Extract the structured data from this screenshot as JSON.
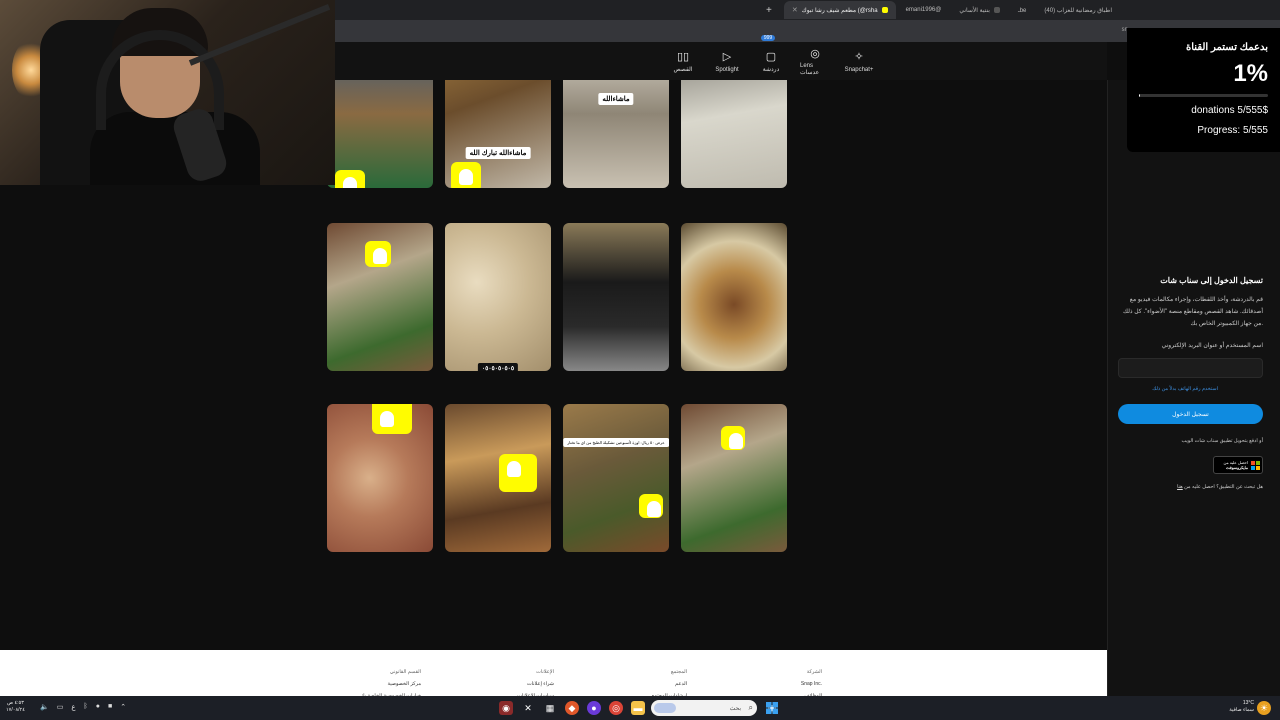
{
  "browser": {
    "tabs": [
      {
        "title": "(40) اطباق رمضانية للعزاب"
      },
      {
        "title": "ـbe"
      },
      {
        "title": "بنتية الأساني"
      },
      {
        "title": "emani1996@"
      },
      {
        "title": "مطعم شيف رشا تبوك (@rsha"
      }
    ],
    "new_tab": "+",
    "url_fragment": "sn"
  },
  "snapnav": {
    "items": [
      {
        "label": "القصص",
        "icon": "stories-icon",
        "glyph": "▯▯"
      },
      {
        "label": "Spotlight",
        "icon": "spotlight-icon",
        "glyph": "▷"
      },
      {
        "label": "دردشة",
        "icon": "chat-icon",
        "glyph": "▢",
        "badge": "999"
      },
      {
        "label": "Lens عدسات",
        "icon": "lens-icon",
        "glyph": "◎"
      },
      {
        "label": "Snapchat+",
        "icon": "snapchat-plus-icon",
        "glyph": "✧"
      }
    ]
  },
  "tiles": {
    "r0c1": "ماشاءالله تبارك الله",
    "r0c2": "ماشاءالله",
    "r1c1": "٠٥٠٥٠٥٠٥٠٥",
    "r2c2": "عرض ٥٠ ريال: اوزة لأسبوعين تشكيلة الطبخ من اي ما تختار"
  },
  "donations": {
    "title": "بدعمك تستمر القناة",
    "percent": "1%",
    "progress_fraction": 0.01,
    "amount": "donations 5/555$",
    "progress": "Progress: 5/555"
  },
  "login": {
    "title": "تسجيل الدخول إلى سناب شات",
    "description": "قم بالدردشة، وأخذ اللقطات، وإجراء مكالمات فيديو مع أصدقائك. شاهد القصص ومقاطع منصة \"الأضواء\". كل ذلك من جهاز الكمبيوتر الخاص بك.",
    "username_label": "اسم المستخدم أو عنوان البريد الإلكتروني",
    "username_value": "",
    "phone_link": "استخدم رقم الهاتف بدلاً من ذلك",
    "button": "تسجيل الدخول",
    "alt_text": "أو ادفع بتحويل تطبيق سناب شات الويب",
    "ms_line1": "احصل عليه من",
    "ms_line2": "مايكروسوفت",
    "get_app_text": "هل تبحث عن التطبيق؟ احصل عليه من",
    "get_app_link": "هنا"
  },
  "footer": {
    "columns": [
      {
        "heading": "الشركة",
        "items": [
          "Snap Inc.",
          "الوظائف"
        ]
      },
      {
        "heading": "المجتمع",
        "items": [
          "الدعم",
          "إرشادات المجتمع"
        ]
      },
      {
        "heading": "الإعلانات",
        "items": [
          "شراء إعلانات",
          "سياسات الإعلانات"
        ]
      },
      {
        "heading": "القسم القانوني",
        "items": [
          "مركز الخصوصية",
          "خيارات الخصوصية الخاصة بك"
        ]
      }
    ]
  },
  "taskbar": {
    "search_text": "بحث",
    "clock_time": "٤:٥٣ ص",
    "clock_date": "١٧/٠٨/٢٤",
    "weather_temp": "13°C",
    "weather_desc": "سماء صافية",
    "lang": "ع"
  }
}
